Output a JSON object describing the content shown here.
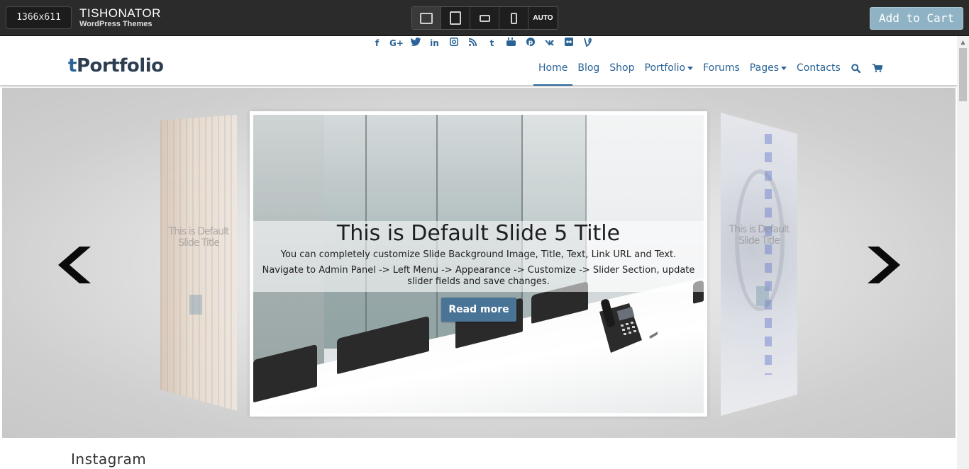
{
  "demo_bar": {
    "resolution": "1366x611",
    "brand_name": "TISHONATOR",
    "brand_sub": "WordPress Themes",
    "devices": [
      {
        "name": "desktop-icon"
      },
      {
        "name": "tablet-portrait-icon"
      },
      {
        "name": "tablet-landscape-icon"
      },
      {
        "name": "mobile-icon"
      },
      {
        "name": "auto",
        "label": "AUTO"
      }
    ],
    "add_to_cart": "Add to Cart"
  },
  "site": {
    "logo_prefix": "t",
    "logo_rest": "Portfolio",
    "socials": [
      "f",
      "G+",
      "twitter-icon",
      "in",
      "instagram-icon",
      "rss-icon",
      "t",
      "youtube-icon",
      "pinterest-icon",
      "vk-icon",
      "flickr-icon",
      "vine-icon"
    ],
    "nav": [
      {
        "label": "Home",
        "active": true
      },
      {
        "label": "Blog"
      },
      {
        "label": "Shop"
      },
      {
        "label": "Portfolio",
        "dropdown": true
      },
      {
        "label": "Forums"
      },
      {
        "label": "Pages",
        "dropdown": true
      },
      {
        "label": "Contacts"
      }
    ],
    "nav_icons": [
      "search-icon",
      "cart-icon"
    ]
  },
  "slider": {
    "title": "This is Default Slide 5 Title",
    "text1": "You can completely customize Slide Background Image, Title, Text, Link URL and Text.",
    "text2": "Navigate to Admin Panel -> Left Menu -> Appearance -> Customize -> Slider Section, update slider fields and save changes.",
    "button": "Read more",
    "side_title": "This is Default Slide Title"
  },
  "section": {
    "instagram": "Instagram"
  },
  "colors": {
    "accent": "#2a6496",
    "button": "#4a7496",
    "cart_button": "#8fb3c4",
    "topbar": "#2b2b2b"
  }
}
